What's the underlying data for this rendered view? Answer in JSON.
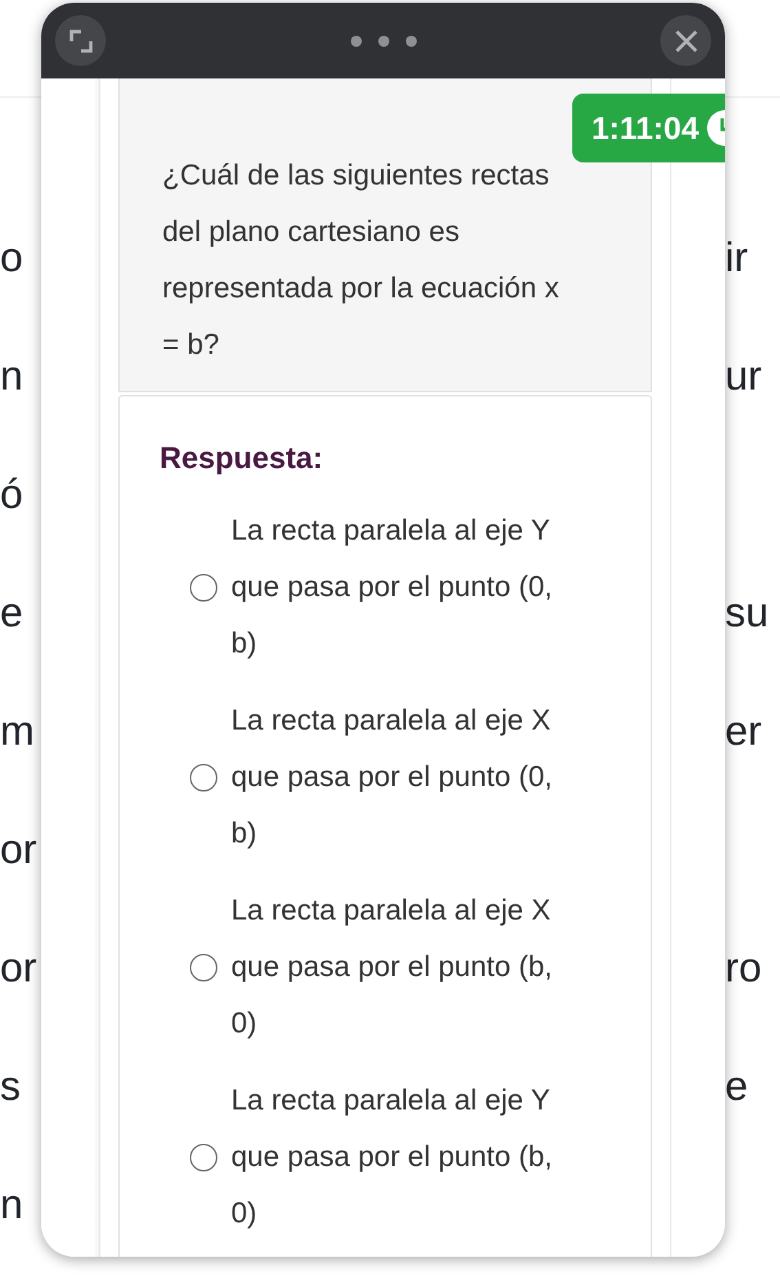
{
  "background": {
    "lines": [
      {
        "left": "o",
        "right": "ir"
      },
      {
        "left": "n",
        "right": "ur"
      },
      {
        "left": "ó"
      },
      {
        "left": "e",
        "right": "su"
      },
      {
        "left": "m",
        "right": "er"
      },
      {
        "left": "or"
      },
      {
        "left": "or",
        "right": "ro"
      },
      {
        "left": "s",
        "right": "e"
      },
      {
        "left": "n"
      }
    ]
  },
  "timer": {
    "time": "1:11:04"
  },
  "question": {
    "text": "¿Cuál de las siguientes rectas del plano cartesiano es representada por la ecuación x = b?"
  },
  "answer": {
    "heading": "Respuesta:",
    "options": [
      {
        "text": "La recta paralela al eje Y que pasa por el punto (0, b)",
        "selected": false
      },
      {
        "text": "La recta paralela al eje X que pasa por el punto (0, b)",
        "selected": false
      },
      {
        "text": "La recta paralela al eje X que pasa por el punto (b, 0)",
        "selected": false
      },
      {
        "text": "La recta paralela al eje Y que pasa por el punto (b, 0)",
        "selected": false
      }
    ]
  }
}
